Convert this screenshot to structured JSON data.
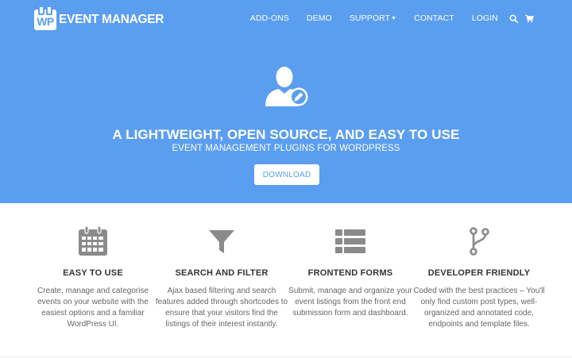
{
  "header": {
    "logo_badge": "WP",
    "logo_text": "EVENT MANAGER",
    "nav": [
      {
        "label": "ADD-ONS"
      },
      {
        "label": "DEMO"
      },
      {
        "label": "SUPPORT"
      },
      {
        "label": "CONTACT"
      },
      {
        "label": "LOGIN"
      }
    ],
    "search_icon": "search-icon",
    "cart_icon": "cart-icon"
  },
  "hero": {
    "icon": "user-edit-icon",
    "title": "A LIGHTWEIGHT, OPEN SOURCE, AND EASY TO USE",
    "subtitle": "EVENT MANAGEMENT PLUGINS FOR WORDPRESS",
    "button_label": "DOWNLOAD"
  },
  "features": [
    {
      "icon": "calendar-icon",
      "title": "EASY TO USE",
      "description": "Create, manage and categorise events on your website with the easiest options and a familiar WordPress UI."
    },
    {
      "icon": "filter-icon",
      "title": "SEARCH AND FILTER",
      "description": "Ajax based filtering and search features added through shortcodes to ensure that your visitors find the listings of their interest instantly."
    },
    {
      "icon": "list-icon",
      "title": "FRONTEND FORMS",
      "description": "Submit, manage and organize your event listings from the front end submission form and dashboard."
    },
    {
      "icon": "code-branch-icon",
      "title": "DEVELOPER FRIENDLY",
      "description": "Coded with the best practices – You'll only find custom post types, well-organized and annotated code, endpoints and template files."
    }
  ],
  "colors": {
    "hero_bg": "#5b9ef0",
    "text_dark": "#333333",
    "text_muted": "#666666",
    "icon_gray": "#8a8a8a"
  }
}
